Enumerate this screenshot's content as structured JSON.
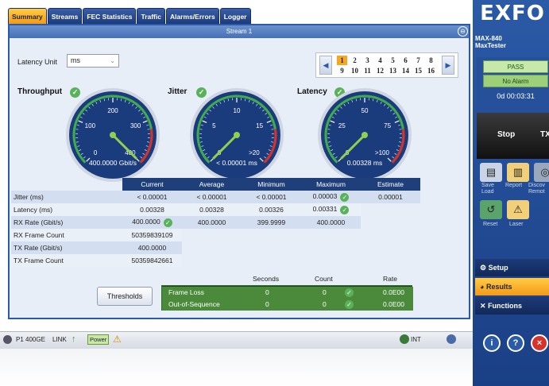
{
  "tabs": [
    {
      "label": "Summary",
      "active": true
    },
    {
      "label": "Streams"
    },
    {
      "label": "FEC Statistics"
    },
    {
      "label": "Traffic"
    },
    {
      "label": "Alarms/Errors"
    },
    {
      "label": "Logger"
    }
  ],
  "stream": {
    "title": "Stream 1",
    "zoom_icon": "zoom-icon"
  },
  "latency_unit": {
    "label": "Latency Unit",
    "value": "ms"
  },
  "pager": {
    "pages_top": [
      "1",
      "2",
      "3",
      "4",
      "5",
      "6",
      "7",
      "8"
    ],
    "pages_bottom": [
      "9",
      "10",
      "11",
      "12",
      "13",
      "14",
      "15",
      "16"
    ],
    "active": "1"
  },
  "gauges": [
    {
      "title": "Throughput",
      "ticks": [
        "0",
        "100",
        "200",
        "300",
        "400"
      ],
      "value_text": "400.0000 Gbit/s",
      "needle_fraction": 1.0
    },
    {
      "title": "Jitter",
      "ticks": [
        "0",
        "5",
        "10",
        "15",
        ">20"
      ],
      "value_text": "< 0.00001 ms",
      "needle_fraction": 0.0
    },
    {
      "title": "Latency",
      "ticks": [
        "0",
        "25",
        "50",
        "75",
        ">100"
      ],
      "value_text": "0.00328 ms",
      "needle_fraction": 0.0
    }
  ],
  "table": {
    "headers": [
      "Current",
      "Average",
      "Minimum",
      "Maximum",
      "Estimate"
    ],
    "rows": [
      {
        "label": "Jitter (ms)",
        "cells": [
          "< 0.00001",
          "< 0.00001",
          "< 0.00001",
          "0.00003",
          "0.00001"
        ],
        "checks": [
          3
        ]
      },
      {
        "label": "Latency (ms)",
        "cells": [
          "0.00328",
          "0.00328",
          "0.00326",
          "0.00331",
          ""
        ],
        "checks": [
          3
        ]
      },
      {
        "label": "RX Rate (Gbit/s)",
        "cells": [
          "400.0000",
          "400.0000",
          "399.9999",
          "400.0000",
          ""
        ],
        "checks": [
          0
        ]
      },
      {
        "label": "RX Frame Count",
        "cells": [
          "50359839109",
          "",
          "",
          "",
          ""
        ]
      },
      {
        "label": "TX Rate (Gbit/s)",
        "cells": [
          "400.0000",
          "",
          "",
          "",
          ""
        ]
      },
      {
        "label": "TX Frame Count",
        "cells": [
          "50359842661",
          "",
          "",
          "",
          ""
        ]
      }
    ]
  },
  "thresholds_label": "Thresholds",
  "frame_table": {
    "headers": [
      "Seconds",
      "Count",
      "Rate"
    ],
    "rows": [
      {
        "label": "Frame Loss",
        "seconds": "0",
        "count": "0",
        "rate": "0.0E00"
      },
      {
        "label": "Out-of-Sequence",
        "seconds": "0",
        "count": "0",
        "rate": "0.0E00"
      }
    ]
  },
  "status": {
    "port": "P1 400GE",
    "link": "LINK",
    "power": "Power",
    "clock": "INT"
  },
  "side": {
    "brand": "EXFO",
    "model": "MAX-840",
    "model_sub": "MaxTester",
    "pass": "PASS",
    "alarm": "No Alarm",
    "timer": "0d 00:03:31",
    "stop": "Stop",
    "tx": "TX",
    "tools": [
      {
        "label": "Save\nLoad"
      },
      {
        "label": "Report"
      },
      {
        "label": "Discov\nRemot"
      },
      {
        "label": "Reset"
      },
      {
        "label": "Laser"
      }
    ],
    "menu": [
      {
        "label": "Setup"
      },
      {
        "label": "Results",
        "active": true
      },
      {
        "label": "Functions"
      }
    ]
  },
  "colors": {
    "accent": "#f29a1a",
    "brand_blue": "#1f3f7a",
    "gauge_bg": "#1b3c7c",
    "ok_green": "#59b259"
  }
}
